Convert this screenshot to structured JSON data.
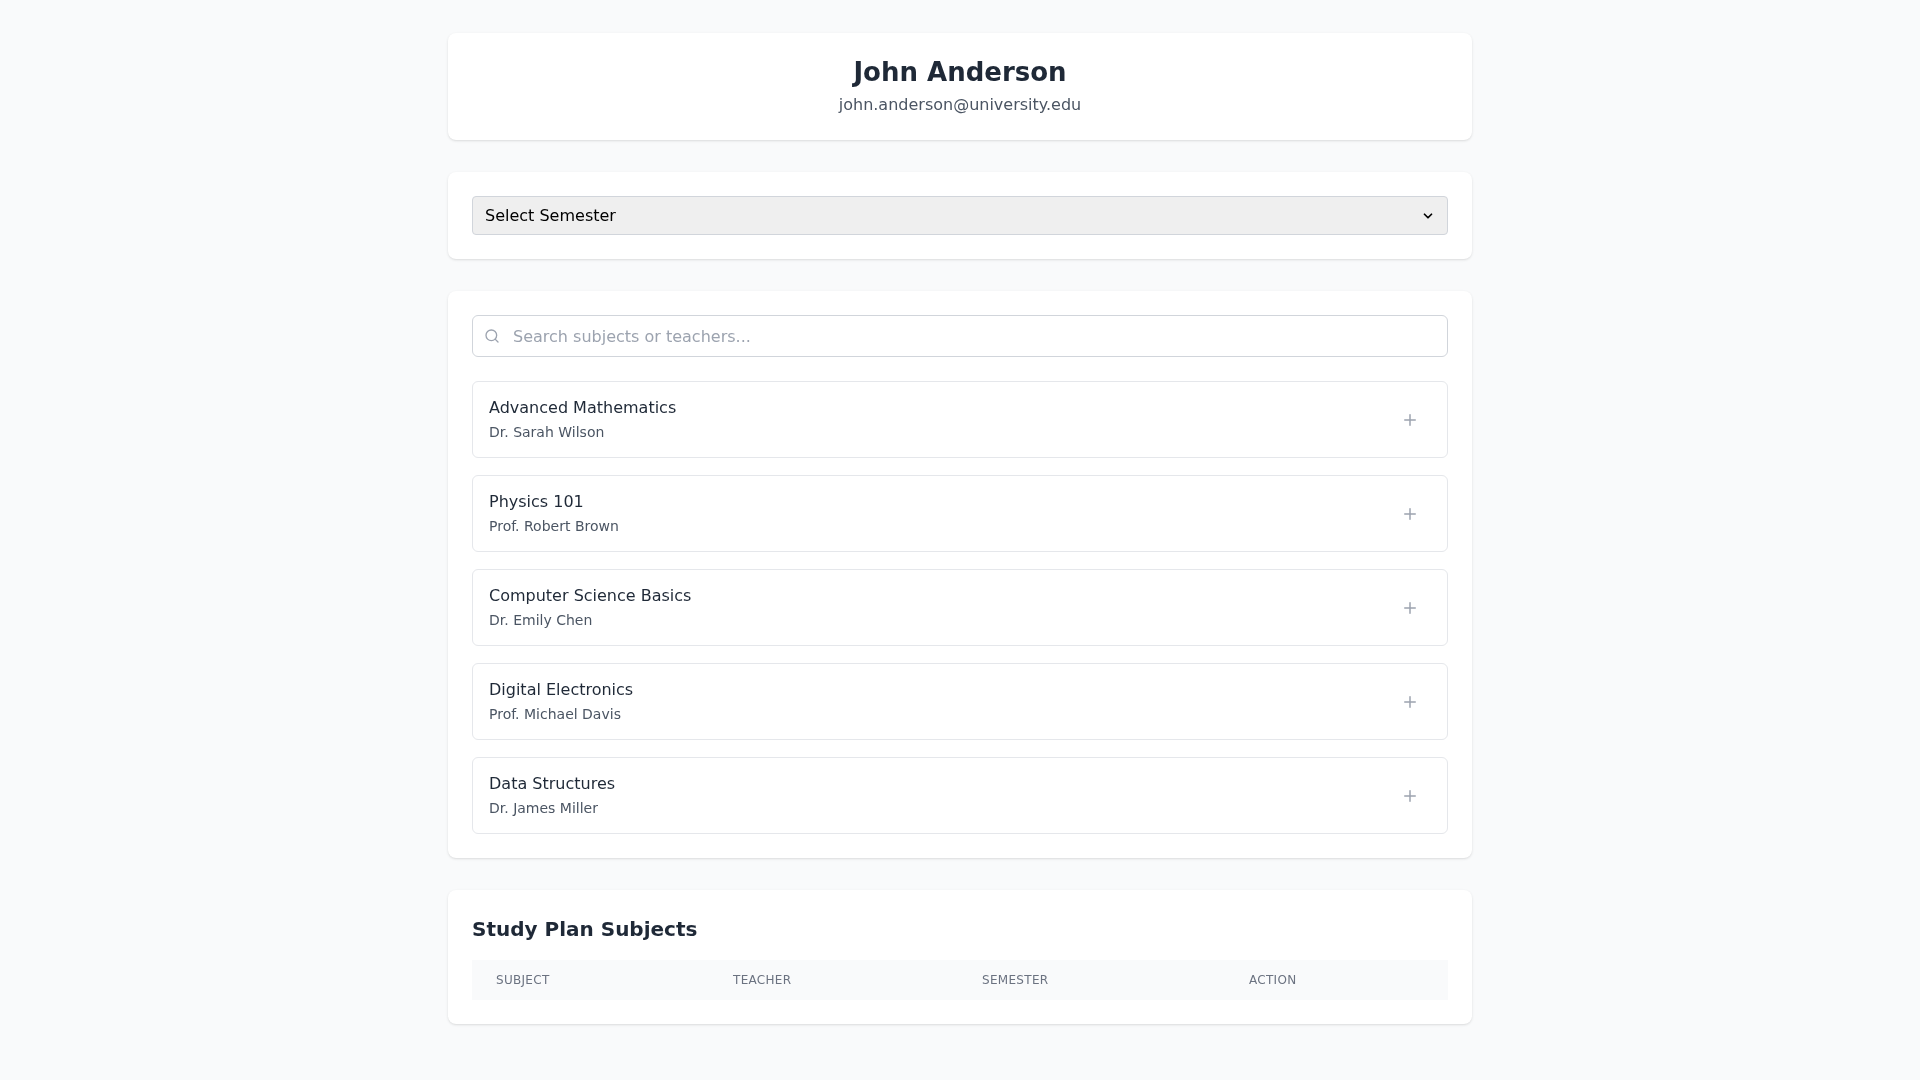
{
  "profile": {
    "name": "John Anderson",
    "email": "john.anderson@university.edu"
  },
  "semester_select": {
    "value": "Select Semester"
  },
  "search": {
    "placeholder": "Search subjects or teachers..."
  },
  "subjects": [
    {
      "title": "Advanced Mathematics",
      "teacher": "Dr. Sarah Wilson"
    },
    {
      "title": "Physics 101",
      "teacher": "Prof. Robert Brown"
    },
    {
      "title": "Computer Science Basics",
      "teacher": "Dr. Emily Chen"
    },
    {
      "title": "Digital Electronics",
      "teacher": "Prof. Michael Davis"
    },
    {
      "title": "Data Structures",
      "teacher": "Dr. James Miller"
    }
  ],
  "study_plan": {
    "title": "Study Plan Subjects",
    "columns": [
      "SUBJECT",
      "TEACHER",
      "SEMESTER",
      "ACTION"
    ]
  }
}
